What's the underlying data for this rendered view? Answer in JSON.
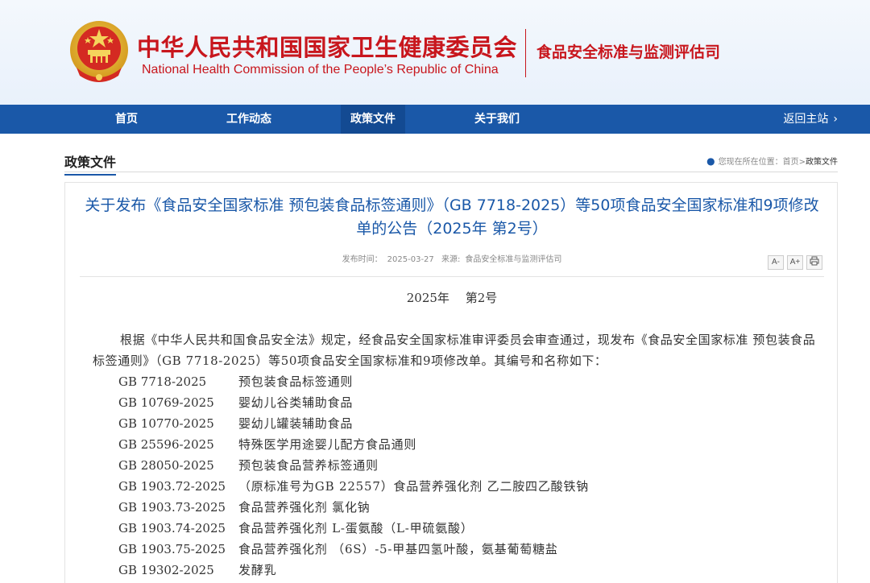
{
  "header": {
    "title_cn": "中华人民共和国国家卫生健康委员会",
    "title_en": "National Health Commission of the People’s Republic of China",
    "department": "食品安全标准与监测评估司"
  },
  "nav": {
    "items": [
      {
        "label": "首页"
      },
      {
        "label": "工作动态"
      },
      {
        "label": "政策文件"
      },
      {
        "label": "关于我们"
      }
    ],
    "back_label": "返回主站"
  },
  "section": {
    "title": "政策文件",
    "location_label": "您现在所在位置：",
    "crumb_home": "首页",
    "crumb_sep": ">",
    "crumb_current": "政策文件"
  },
  "article": {
    "title": "关于发布《食品安全国家标准 预包装食品标签通则》（GB 7718-2025）等50项食品安全国家标准和9项修改单的公告（2025年 第2号）",
    "date_label": "发布时间：",
    "date": "2025-03-27",
    "source_label": "来源:",
    "source": "食品安全标准与监测评估司",
    "tools": [
      "A-",
      "A+",
      "print-icon"
    ],
    "issue": "2025年　 第2号",
    "paragraph": "根据《中华人民共和国食品安全法》规定，经食品安全国家标准审评委员会审查通过，现发布《食品安全国家标准 预包装食品标签通则》（GB 7718-2025）等50项食品安全国家标准和9项修改单。其编号和名称如下：",
    "standards": [
      {
        "code": "GB 7718-2025",
        "name": "预包装食品标签通则"
      },
      {
        "code": "GB 10769-2025",
        "name": "婴幼儿谷类辅助食品"
      },
      {
        "code": "GB 10770-2025",
        "name": "婴幼儿罐装辅助食品"
      },
      {
        "code": "GB 25596-2025",
        "name": "特殊医学用途婴儿配方食品通则"
      },
      {
        "code": "GB 28050-2025",
        "name": "预包装食品营养标签通则"
      },
      {
        "code": "GB 1903.72-2025",
        "name": "（原标准号为GB 22557）食品营养强化剂 乙二胺四乙酸铁钠"
      },
      {
        "code": "GB 1903.73-2025",
        "name": "食品营养强化剂 氯化钠"
      },
      {
        "code": "GB 1903.74-2025",
        "name": "食品营养强化剂 L-蛋氨酸（L-甲硫氨酸）"
      },
      {
        "code": "GB 1903.75-2025",
        "name": "食品营养强化剂 （6S）-5-甲基四氢叶酸，氨基葡萄糖盐"
      },
      {
        "code": "GB 19302-2025",
        "name": "发酵乳"
      }
    ]
  },
  "colors": {
    "brand_red": "#c8161d",
    "nav_blue": "#1a58a8",
    "title_blue": "#1a58a8"
  }
}
